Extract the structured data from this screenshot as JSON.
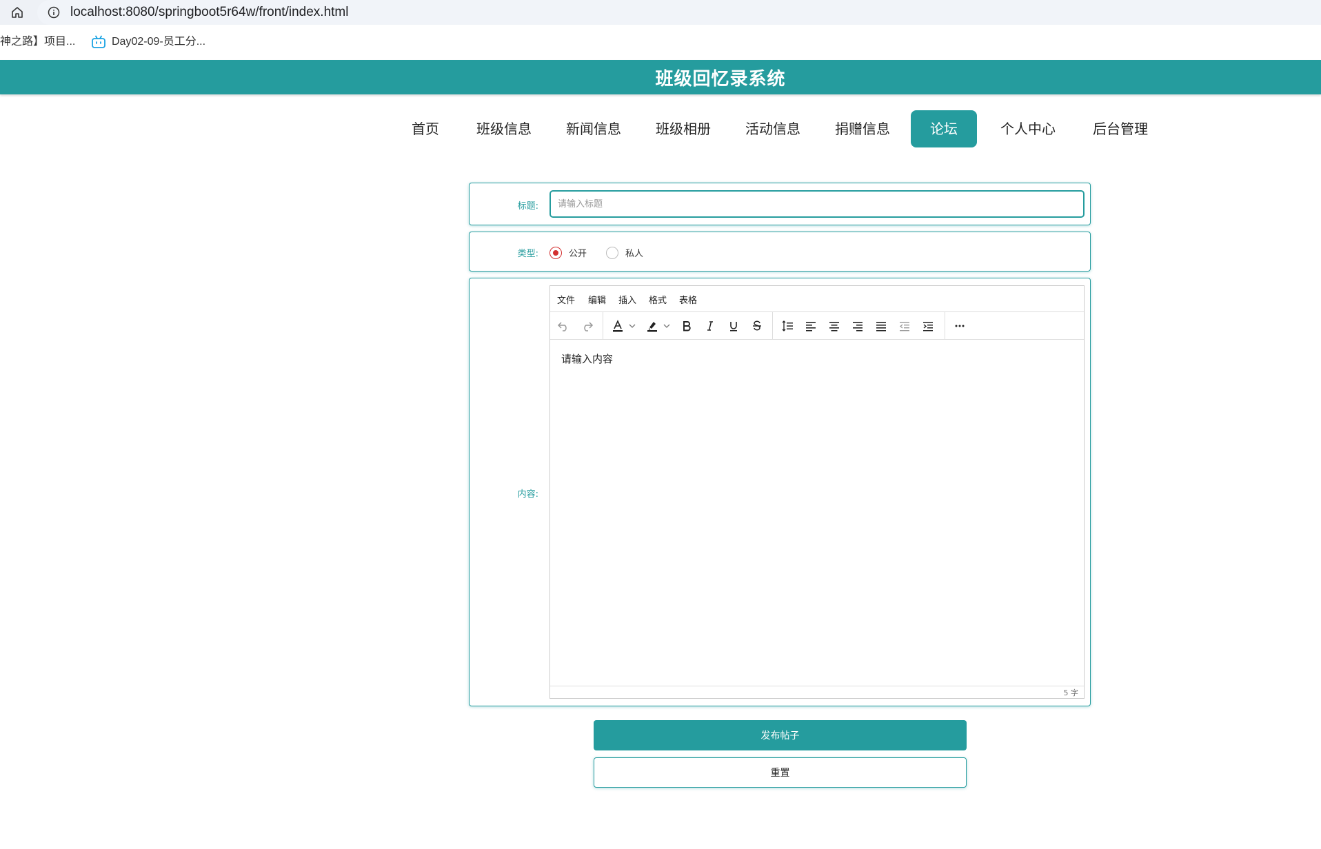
{
  "browser": {
    "url": "localhost:8080/springboot5r64w/front/index.html",
    "bookmarks": [
      {
        "label": "神之路】项目..."
      },
      {
        "label": "Day02-09-员工分..."
      }
    ]
  },
  "header": {
    "title": "班级回忆录系统"
  },
  "nav": {
    "items": [
      {
        "label": "首页"
      },
      {
        "label": "班级信息"
      },
      {
        "label": "新闻信息"
      },
      {
        "label": "班级相册"
      },
      {
        "label": "活动信息"
      },
      {
        "label": "捐赠信息"
      },
      {
        "label": "论坛"
      },
      {
        "label": "个人中心"
      },
      {
        "label": "后台管理"
      }
    ],
    "active_index": 6
  },
  "form": {
    "title_label": "标题:",
    "title_placeholder": "请输入标题",
    "title_value": "",
    "type_label": "类型:",
    "type_options": [
      {
        "label": "公开",
        "checked": true
      },
      {
        "label": "私人",
        "checked": false
      }
    ],
    "content_label": "内容:",
    "editor": {
      "menus": [
        "文件",
        "编辑",
        "插入",
        "格式",
        "表格"
      ],
      "placeholder": "请输入内容",
      "word_count": "5 字"
    },
    "submit_label": "发布帖子",
    "reset_label": "重置"
  },
  "colors": {
    "accent": "#259c9e",
    "radio_checked": "#d32f2f"
  }
}
